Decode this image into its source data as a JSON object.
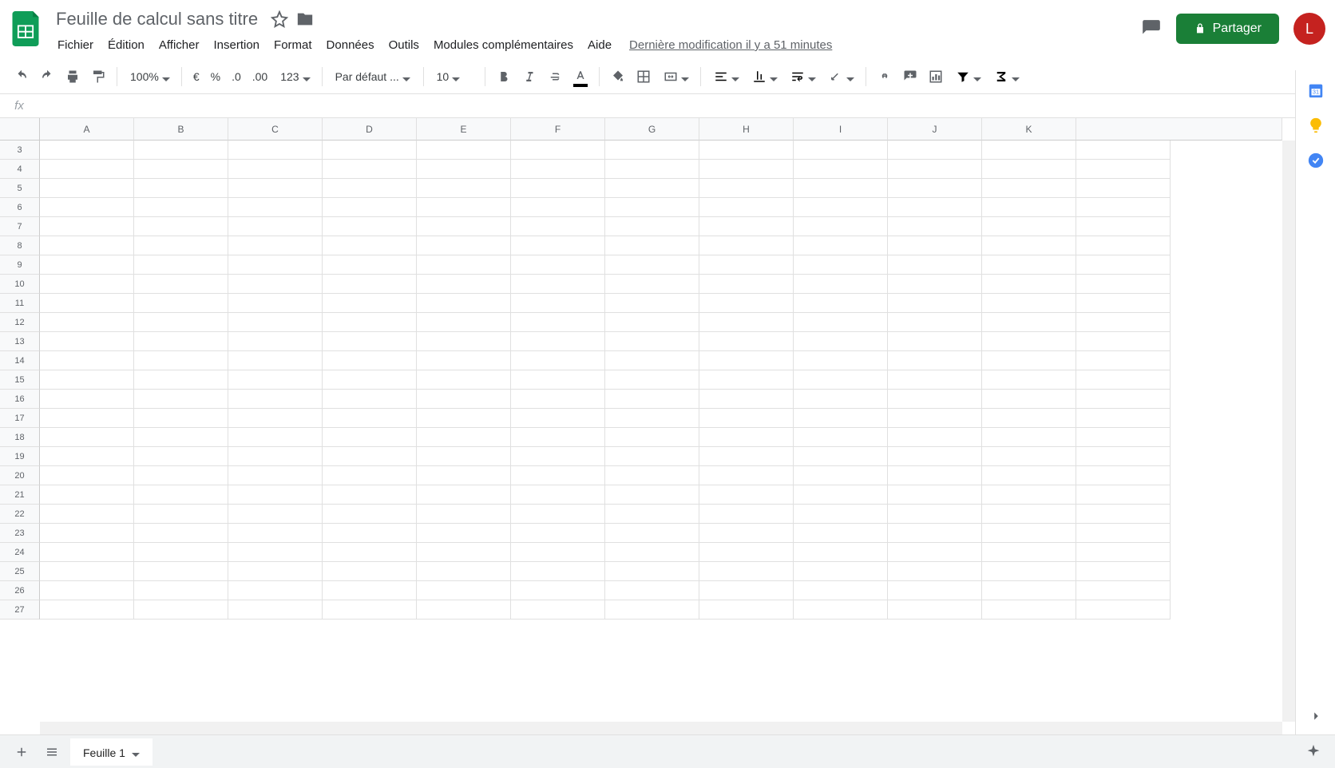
{
  "doc": {
    "title": "Feuille de calcul sans titre",
    "last_edit": "Dernière modification il y a 51 minutes"
  },
  "menubar": [
    "Fichier",
    "Édition",
    "Afficher",
    "Insertion",
    "Format",
    "Données",
    "Outils",
    "Modules complémentaires",
    "Aide"
  ],
  "share": {
    "label": "Partager"
  },
  "avatar": {
    "initial": "L"
  },
  "toolbar": {
    "zoom": "100%",
    "currency": "€",
    "percent": "%",
    "dec_less": ".0",
    "dec_more": ".00",
    "num_format": "123",
    "font": "Par défaut ...",
    "font_size": "10"
  },
  "columns": [
    "A",
    "B",
    "C",
    "D",
    "E",
    "F",
    "G",
    "H",
    "I",
    "J",
    "K"
  ],
  "rows_start": 3,
  "rows_end": 27,
  "sheet": {
    "tab_label": "Feuille 1"
  }
}
